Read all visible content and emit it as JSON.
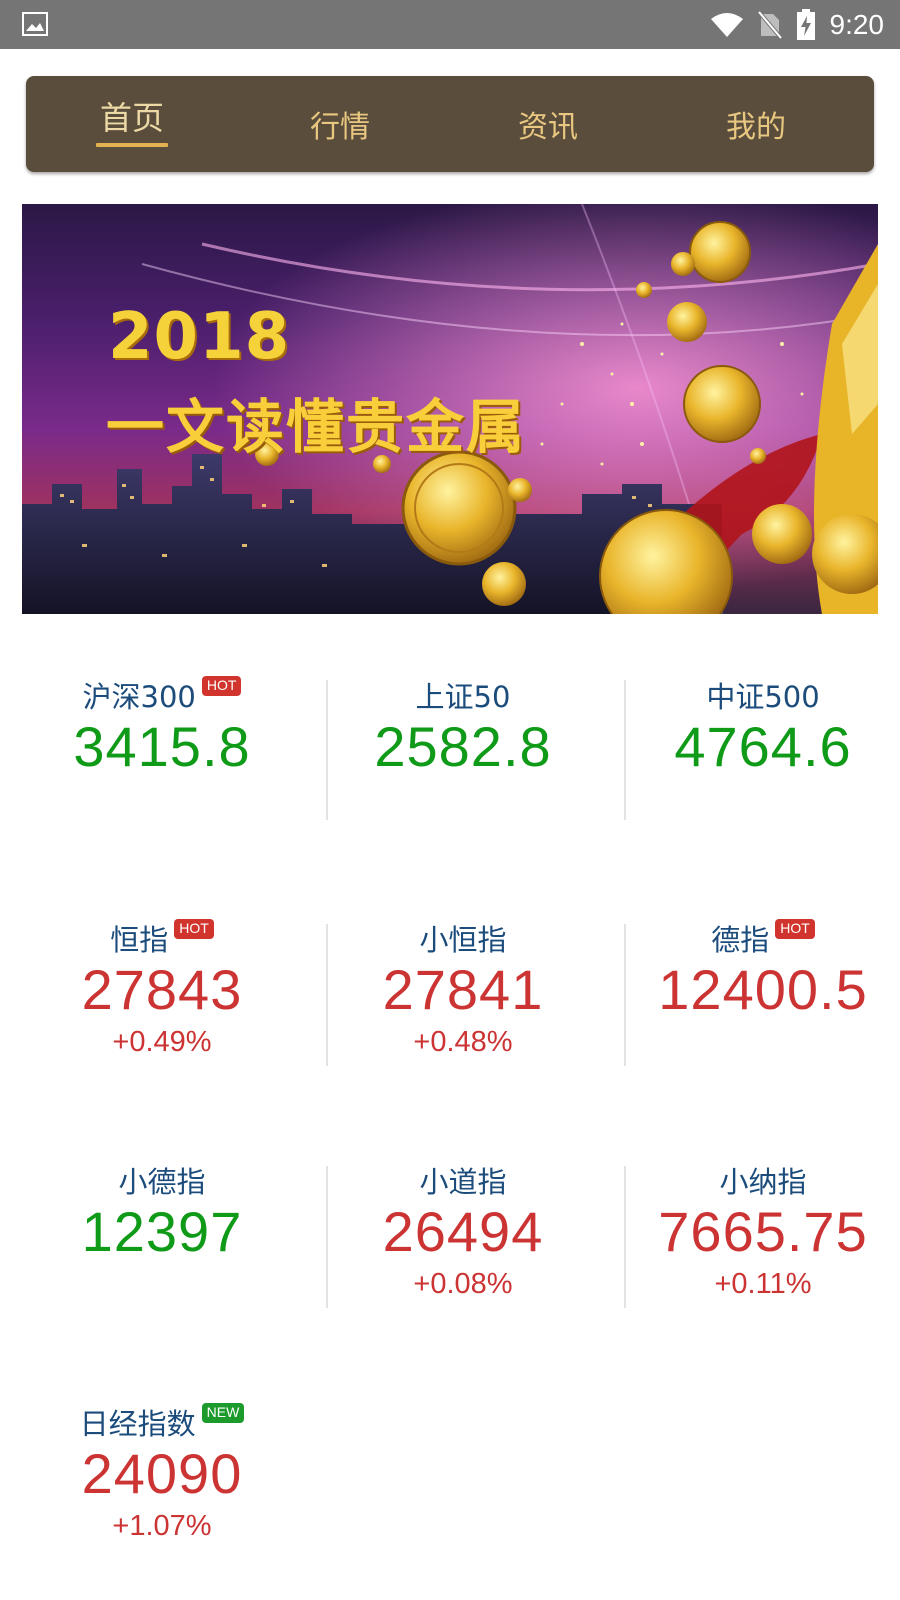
{
  "status_bar": {
    "time": "9:20",
    "icons": [
      "image-icon",
      "wifi-icon",
      "no-sim-icon",
      "battery-charging-icon"
    ]
  },
  "nav": {
    "tabs": [
      {
        "label": "首页",
        "active": true
      },
      {
        "label": "行情",
        "active": false
      },
      {
        "label": "资讯",
        "active": false
      },
      {
        "label": "我的",
        "active": false
      }
    ]
  },
  "banner": {
    "year": "2018",
    "title": "一文读懂贵金属"
  },
  "indices": [
    {
      "name": "沪深300",
      "badge": "HOT",
      "value": "3415.8",
      "change": "",
      "color": "#0f9a18"
    },
    {
      "name": "上证50",
      "badge": "",
      "value": "2582.8",
      "change": "",
      "color": "#0f9a18"
    },
    {
      "name": "中证500",
      "badge": "",
      "value": "4764.6",
      "change": "",
      "color": "#0f9a18"
    },
    {
      "name": "恒指",
      "badge": "HOT",
      "value": "27843",
      "change": "+0.49%",
      "color": "#cc3434"
    },
    {
      "name": "小恒指",
      "badge": "",
      "value": "27841",
      "change": "+0.48%",
      "color": "#cc3434"
    },
    {
      "name": "德指",
      "badge": "HOT",
      "value": "12400.5",
      "change": "",
      "color": "#cc3434"
    },
    {
      "name": "小德指",
      "badge": "",
      "value": "12397",
      "change": "",
      "color": "#0f9a18"
    },
    {
      "name": "小道指",
      "badge": "",
      "value": "26494",
      "change": "+0.08%",
      "color": "#cc3434"
    },
    {
      "name": "小纳指",
      "badge": "",
      "value": "7665.75",
      "change": "+0.11%",
      "color": "#cc3434"
    },
    {
      "name": "日经指数",
      "badge": "NEW",
      "value": "24090",
      "change": "+1.07%",
      "color": "#cc3434"
    }
  ],
  "colors": {
    "up": "#cc3434",
    "down": "#0f9a18",
    "name": "#1c4c7c",
    "nav_bg": "#5b4d3b",
    "nav_text": "#e8c780",
    "nav_underline": "#e4b24e"
  }
}
